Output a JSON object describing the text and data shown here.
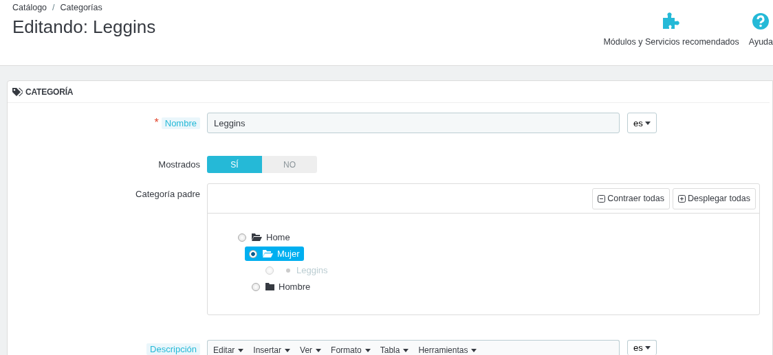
{
  "breadcrumb": {
    "items": [
      "Catálogo",
      "Categorías"
    ],
    "separator": "/"
  },
  "page_title": "Editando: Leggins",
  "toolbar": [
    {
      "kind": "puzzle",
      "label": "Módulos y Servicios recomendados"
    },
    {
      "kind": "help",
      "label": "Ayuda"
    }
  ],
  "panel": {
    "title": "CATEGORÍA"
  },
  "name_field": {
    "label": "Nombre",
    "required_mark": "*",
    "value": "Leggins",
    "language": "es"
  },
  "displayed": {
    "label": "Mostrados",
    "options": [
      {
        "label": "SÍ",
        "selected": true
      },
      {
        "label": "NO",
        "selected": false
      }
    ]
  },
  "parent_category": {
    "label": "Categoría padre",
    "buttons": [
      {
        "kind": "collapse",
        "label": "Contraer todas"
      },
      {
        "kind": "expand",
        "label": "Desplegar todas"
      }
    ],
    "tree": [
      {
        "label": "Home",
        "kind": "folder",
        "expanded": true,
        "selected": false,
        "disabled": false,
        "children": [
          {
            "label": "Mujer",
            "kind": "folder",
            "expanded": true,
            "selected": true,
            "disabled": false,
            "children": [
              {
                "label": "Leggins",
                "kind": "leaf",
                "selected": false,
                "disabled": true
              }
            ]
          },
          {
            "label": "Hombre",
            "kind": "folder",
            "expanded": false,
            "selected": false,
            "disabled": false
          }
        ]
      }
    ]
  },
  "description": {
    "label": "Descripción",
    "menus": [
      "Editar",
      "Insertar",
      "Ver",
      "Formato",
      "Tabla",
      "Herramientas"
    ],
    "language": "es"
  }
}
